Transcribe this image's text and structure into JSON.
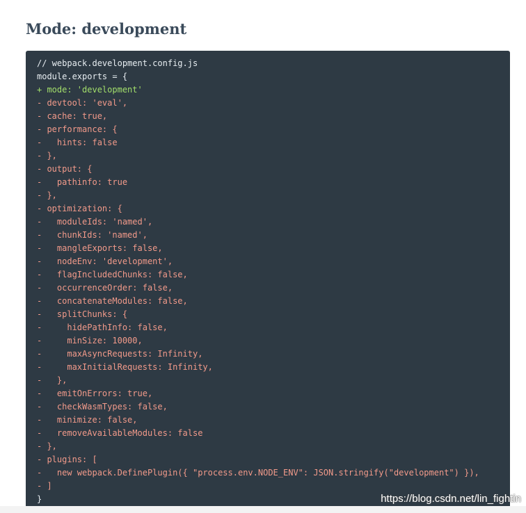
{
  "page": {
    "title": "Mode: development"
  },
  "code": {
    "colors": {
      "background": "#2e3a44",
      "plain": "#e7edf1",
      "added": "#a3df6b",
      "removed": "#f29a8a"
    },
    "lines": [
      {
        "text": "// webpack.development.config.js",
        "kind": "plain"
      },
      {
        "text": "module.exports = {",
        "kind": "plain"
      },
      {
        "text": "+ mode: 'development'",
        "kind": "add"
      },
      {
        "text": "- devtool: 'eval',",
        "kind": "remove"
      },
      {
        "text": "- cache: true,",
        "kind": "remove"
      },
      {
        "text": "- performance: {",
        "kind": "remove"
      },
      {
        "text": "-   hints: false",
        "kind": "remove"
      },
      {
        "text": "- },",
        "kind": "remove"
      },
      {
        "text": "- output: {",
        "kind": "remove"
      },
      {
        "text": "-   pathinfo: true",
        "kind": "remove"
      },
      {
        "text": "- },",
        "kind": "remove"
      },
      {
        "text": "- optimization: {",
        "kind": "remove"
      },
      {
        "text": "-   moduleIds: 'named',",
        "kind": "remove"
      },
      {
        "text": "-   chunkIds: 'named',",
        "kind": "remove"
      },
      {
        "text": "-   mangleExports: false,",
        "kind": "remove"
      },
      {
        "text": "-   nodeEnv: 'development',",
        "kind": "remove"
      },
      {
        "text": "-   flagIncludedChunks: false,",
        "kind": "remove"
      },
      {
        "text": "-   occurrenceOrder: false,",
        "kind": "remove"
      },
      {
        "text": "-   concatenateModules: false,",
        "kind": "remove"
      },
      {
        "text": "-   splitChunks: {",
        "kind": "remove"
      },
      {
        "text": "-     hidePathInfo: false,",
        "kind": "remove"
      },
      {
        "text": "-     minSize: 10000,",
        "kind": "remove"
      },
      {
        "text": "-     maxAsyncRequests: Infinity,",
        "kind": "remove"
      },
      {
        "text": "-     maxInitialRequests: Infinity,",
        "kind": "remove"
      },
      {
        "text": "-   },",
        "kind": "remove"
      },
      {
        "text": "-   emitOnErrors: true,",
        "kind": "remove"
      },
      {
        "text": "-   checkWasmTypes: false,",
        "kind": "remove"
      },
      {
        "text": "-   minimize: false,",
        "kind": "remove"
      },
      {
        "text": "-   removeAvailableModules: false",
        "kind": "remove"
      },
      {
        "text": "- },",
        "kind": "remove"
      },
      {
        "text": "- plugins: [",
        "kind": "remove"
      },
      {
        "text": "-   new webpack.DefinePlugin({ \"process.env.NODE_ENV\": JSON.stringify(\"development\") }),",
        "kind": "remove"
      },
      {
        "text": "- ]",
        "kind": "remove"
      },
      {
        "text": "}",
        "kind": "plain"
      }
    ]
  },
  "watermark": {
    "text": "https://blog.csdn.net/lin_fightin"
  }
}
